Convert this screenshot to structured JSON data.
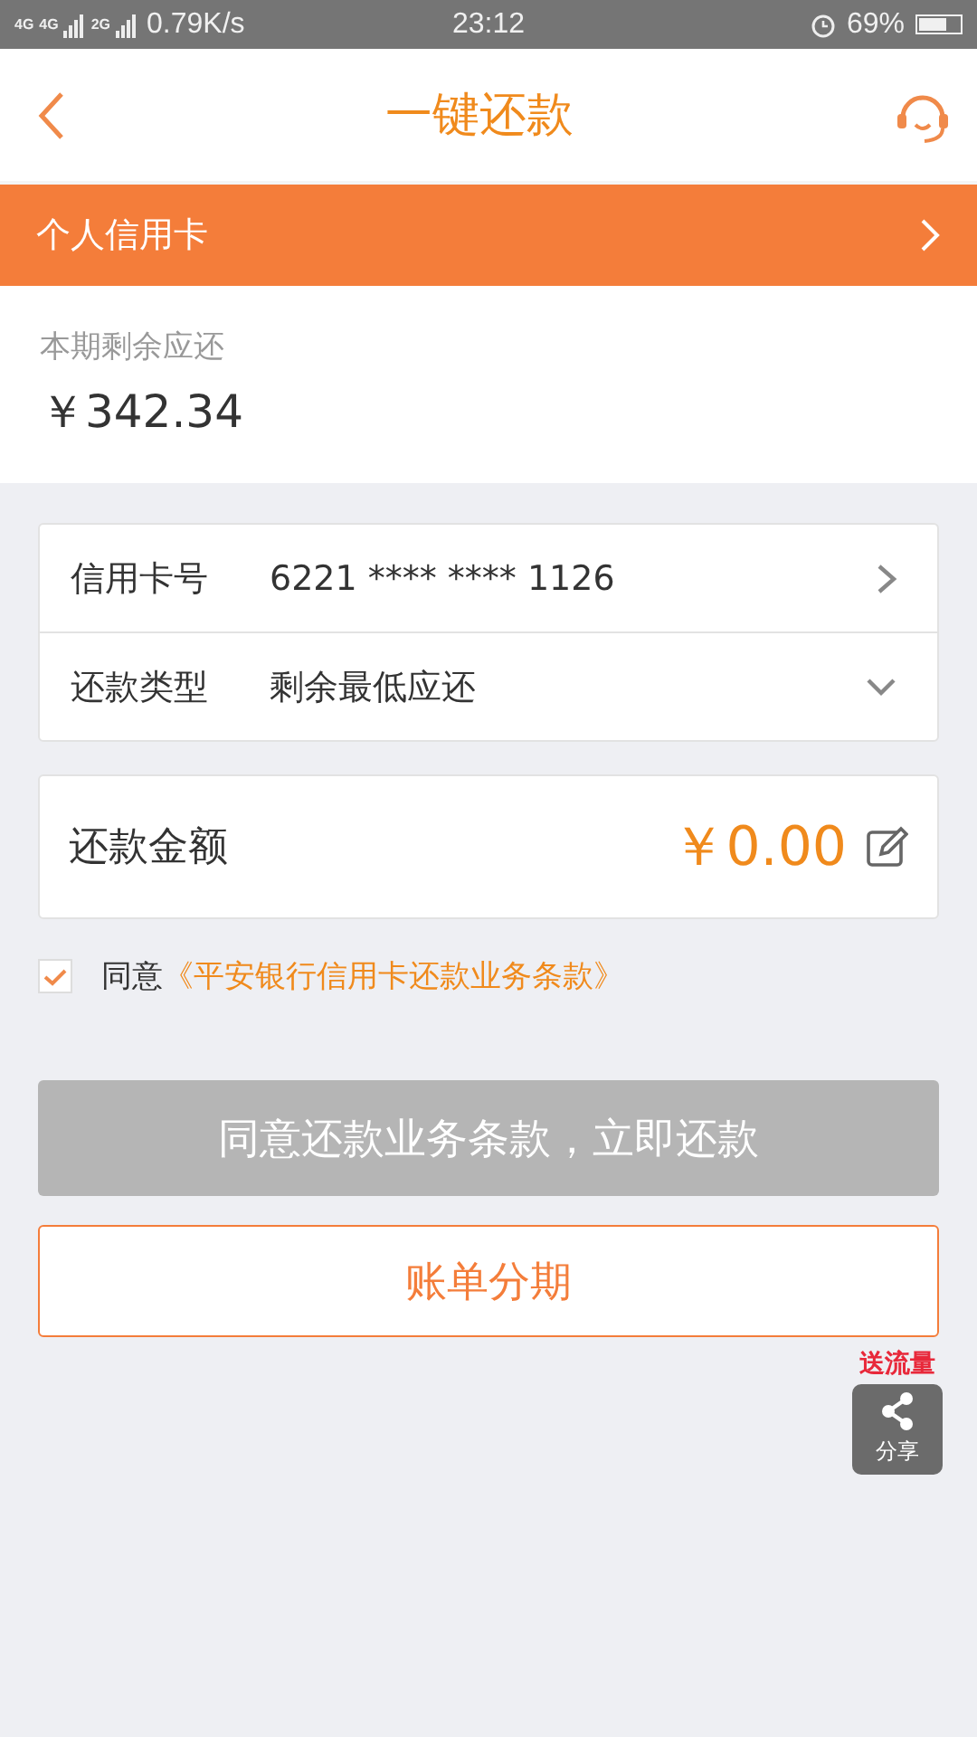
{
  "status_bar": {
    "network_1": "4G",
    "network_2": "4G",
    "network_3": "2G",
    "speed": "0.79K/s",
    "time": "23:12",
    "battery": "69%"
  },
  "header": {
    "title": "一键还款"
  },
  "account_bar": {
    "label": "个人信用卡"
  },
  "summary": {
    "label": "本期剩余应还",
    "amount": "￥342.34"
  },
  "details": [
    {
      "label": "信用卡号",
      "value": "6221 **** **** 1126",
      "kind": "link"
    },
    {
      "label": "还款类型",
      "value": "剩余最低应还",
      "kind": "dropdown"
    }
  ],
  "amount": {
    "label": "还款金额",
    "value": "￥0.00"
  },
  "agreement": {
    "checked": true,
    "text": "同意",
    "link": "《平安银行信用卡还款业务条款》"
  },
  "pay_button": {
    "label": "同意还款业务条款，立即还款",
    "disabled": true
  },
  "installment_button": {
    "label": "账单分期"
  },
  "share": {
    "badge": "送流量",
    "label": "分享"
  }
}
